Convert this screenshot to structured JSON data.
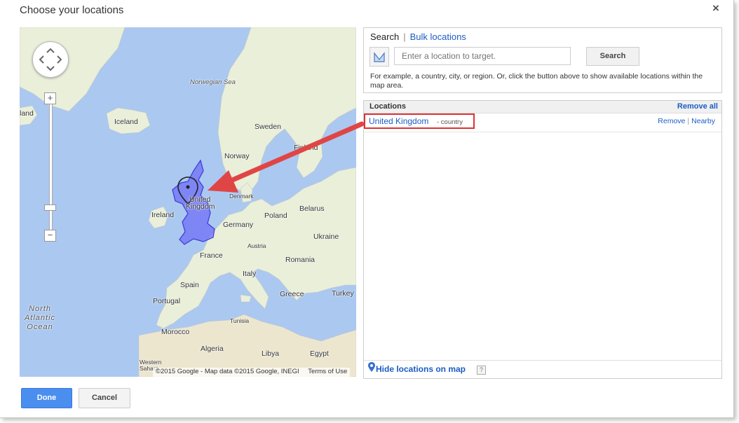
{
  "dialog": {
    "title": "Choose your locations",
    "close_label": "×"
  },
  "map": {
    "labels": {
      "iceland_partial": "land",
      "iceland": "Iceland",
      "norwegian_sea": "Norwegian Sea",
      "sweden": "Sweden",
      "finland": "Finland",
      "norway": "Norway",
      "denmark": "Denmark",
      "united_kingdom_line1": "United",
      "united_kingdom_line2": "Kingdom",
      "ireland": "Ireland",
      "belarus": "Belarus",
      "poland": "Poland",
      "germany": "Germany",
      "ukraine": "Ukraine",
      "austria": "Austria",
      "france": "France",
      "romania": "Romania",
      "italy": "Italy",
      "spain": "Spain",
      "portugal": "Portugal",
      "greece": "Greece",
      "turkey": "Turkey",
      "tunisia": "Tunisia",
      "morocco": "Morocco",
      "algeria": "Algeria",
      "libya": "Libya",
      "egypt": "Egypt",
      "sahara_line1": "Western",
      "sahara_line2": "Sahara",
      "ocean_line1": "North",
      "ocean_line2": "Atlantic",
      "ocean_line3": "Ocean"
    },
    "zoom_in": "+",
    "zoom_out": "−",
    "attribution": "©2015 Google - Map data ©2015 Google, INEGI",
    "terms": "Terms of Use",
    "selected_region_color": "#6f6ff5"
  },
  "search": {
    "tab_search": "Search",
    "tab_separator": "|",
    "tab_bulk": "Bulk locations",
    "placeholder": "Enter a location to target.",
    "button": "Search",
    "hint": "For example, a country, city, or region. Or, click the button above to show available locations within the map area."
  },
  "locations": {
    "header": "Locations",
    "remove_all": "Remove all",
    "items": [
      {
        "name": "United Kingdom",
        "type": "- country",
        "remove": "Remove",
        "nearby": "Nearby"
      }
    ],
    "hide_map": "Hide locations on map",
    "help": "?"
  },
  "footer": {
    "done": "Done",
    "cancel": "Cancel"
  },
  "colors": {
    "accent": "#4a8ef0",
    "link": "#1a5dc4",
    "highlight": "#dd3333",
    "sea": "#abc8f0",
    "land": "#e9efd9"
  }
}
